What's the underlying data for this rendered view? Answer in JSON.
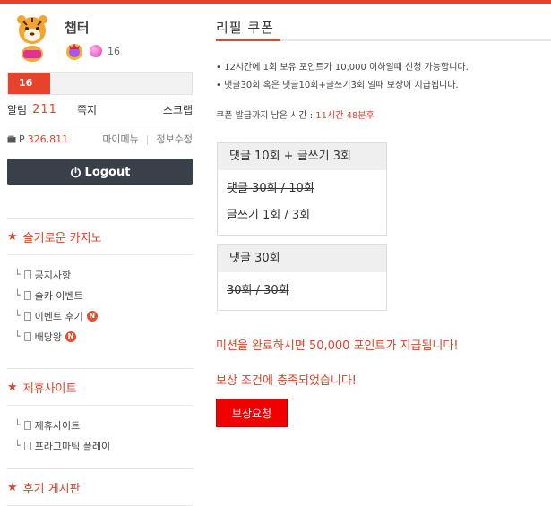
{
  "profile": {
    "nickname": "챕터",
    "level": "16"
  },
  "exp": {
    "label": "16",
    "progress": 0.23
  },
  "alarm": {
    "label": "알림",
    "count": "211",
    "memo": "쪽지",
    "scrap": "스크랩"
  },
  "points": {
    "prefix": "P",
    "value": "326,811",
    "mymenu": "마이메뉴",
    "separator": "|",
    "edit": "정보수정"
  },
  "logout": {
    "label": "Logout"
  },
  "sidebar": {
    "sections": [
      {
        "title": "슬기로운 카지노",
        "items": [
          {
            "label": "공지사항",
            "new": false
          },
          {
            "label": "슬카 이벤트",
            "new": false
          },
          {
            "label": "이벤트 후기",
            "new": true
          },
          {
            "label": "배당왕",
            "new": true
          }
        ]
      },
      {
        "title": "제휴사이트",
        "items": [
          {
            "label": "제휴사이트",
            "new": false
          },
          {
            "label": "프라그마틱 플레이",
            "new": false
          }
        ]
      },
      {
        "title": "후기 게시판",
        "items": []
      }
    ],
    "new_badge": "N"
  },
  "main": {
    "title": "리필 쿠폰",
    "notes": [
      "• 12시간에 1회 보유 포인트가 10,000 이하일때 신청 가능합니다.",
      "• 댓글30회 혹은 댓글10회+글쓰기3회 일때 보상이 지급됩니다."
    ],
    "remain_label": "쿠폰 발급까지 남은 시간 :",
    "remain_time": "11시간 48분후",
    "box1": {
      "header": "댓글 10회 + 글쓰기 3회",
      "line1": "댓글 30회 / 10회",
      "line2": "글쓰기 1회 / 3회"
    },
    "box2": {
      "header": "댓글 30회",
      "line1": "30회 / 30회"
    },
    "mission_msg": "미션을 완료하시면 50,000 포인트가 지급됩니다!",
    "complete_msg": "보상 조건에 충족되었습니다!",
    "reward_button": "보상요청"
  },
  "colors": {
    "accent": "#e8432a",
    "button_red": "#f10000",
    "logout_bg": "#394049"
  }
}
